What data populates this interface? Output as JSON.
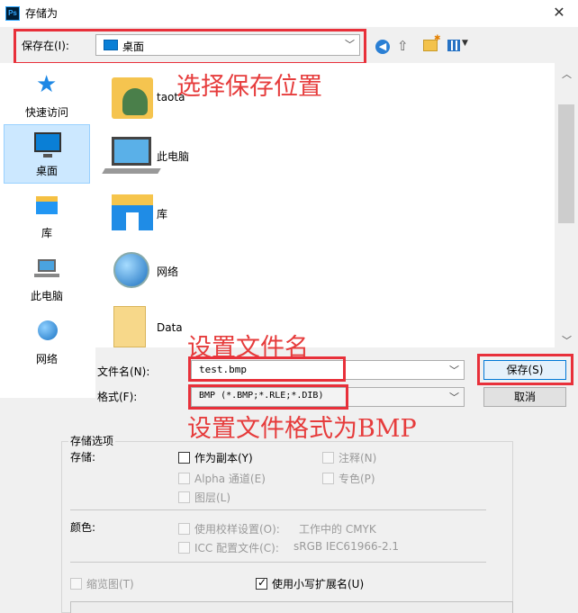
{
  "window": {
    "app_icon": "Ps",
    "title": "存储为",
    "close": "✕"
  },
  "location": {
    "label": "保存在(I):",
    "value": "桌面"
  },
  "annotations": {
    "save_location": "选择保存位置",
    "file_name": "设置文件名",
    "file_format": "设置文件格式为BMP"
  },
  "sidebar": {
    "items": [
      {
        "label": "快速访问",
        "icon": "quick-access-star-icon"
      },
      {
        "label": "桌面",
        "icon": "desktop-icon",
        "selected": true
      },
      {
        "label": "库",
        "icon": "library-icon"
      },
      {
        "label": "此电脑",
        "icon": "this-pc-icon"
      },
      {
        "label": "网络",
        "icon": "network-icon"
      }
    ]
  },
  "files": [
    {
      "name": "taota",
      "icon": "user-folder-icon"
    },
    {
      "name": "此电脑",
      "icon": "computer-icon"
    },
    {
      "name": "库",
      "icon": "library-icon"
    },
    {
      "name": "网络",
      "icon": "network-icon"
    },
    {
      "name": "Data",
      "icon": "folder-icon"
    }
  ],
  "form": {
    "filename_label": "文件名(N):",
    "filename_value": "test.bmp",
    "format_label": "格式(F):",
    "format_value": "BMP (*.BMP;*.RLE;*.DIB)",
    "save_button": "保存(S)",
    "cancel_button": "取消"
  },
  "options": {
    "group_title": "存储选项",
    "save_label": "存储:",
    "as_copy": "作为副本(Y)",
    "annotations": "注释(N)",
    "alpha_channels": "Alpha 通道(E)",
    "spot_colors": "专色(P)",
    "layers": "图层(L)",
    "color_label": "颜色:",
    "use_proof_setup": "使用校样设置(O):",
    "proof_value": "工作中的 CMYK",
    "icc_profile": "ICC 配置文件(C):",
    "icc_value": "sRGB IEC61966-2.1",
    "thumbnail": "缩览图(T)",
    "lowercase_ext": "使用小写扩展名(U)"
  },
  "colors": {
    "annotation_red": "#e63c3c",
    "selected_bg": "#cce8ff"
  }
}
